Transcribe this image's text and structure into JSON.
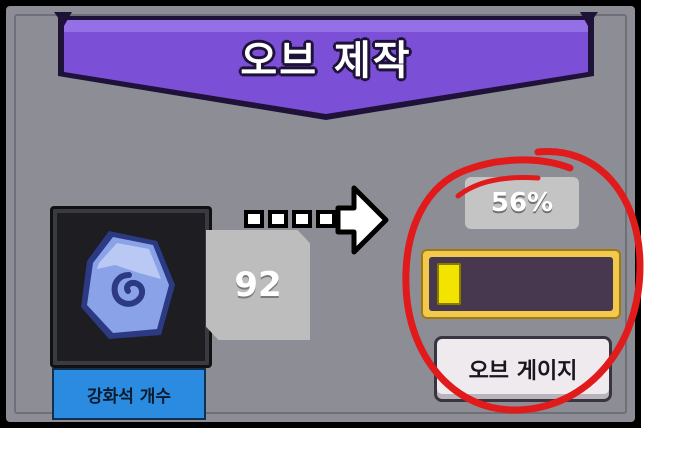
{
  "title": "오브 제작",
  "stone": {
    "icon": "rune-stone-icon",
    "count": "92",
    "label": "강화석 개수"
  },
  "gauge": {
    "percent_text": "56%",
    "fill_fraction": 0.14,
    "button_label": "오브 게이지"
  },
  "colors": {
    "banner": "#7b4fd6",
    "label_button": "#2a8be0",
    "gauge_frame": "#f2c94c",
    "gauge_fill": "#f2e300",
    "annotation": "#e11b1b"
  }
}
